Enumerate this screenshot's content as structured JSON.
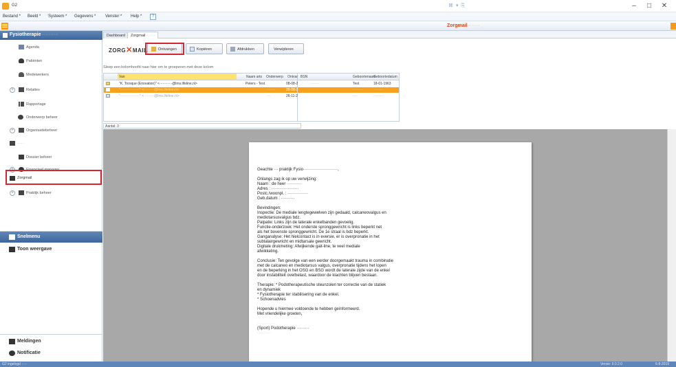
{
  "titlebar": {
    "app_title": "G2",
    "center_icons": "⌘ ▾ ⎘",
    "minimize": "–",
    "maximize": "□",
    "close": "✕"
  },
  "menu": {
    "items": [
      "Bestand *",
      "Beeld *",
      "Systeem *",
      "Gegevens *",
      "Venster *",
      "Help *"
    ]
  },
  "header": {
    "title": "Zorgmail",
    "subtitle": " - ·····"
  },
  "sidebar": {
    "heading": "Fysiotherapie",
    "heading_blur": " ··········",
    "items": [
      {
        "label": "Agenda"
      },
      {
        "label": "Patiënten"
      },
      {
        "label": "Medewerkers"
      },
      {
        "label": "Relaties"
      },
      {
        "label": "Rapportage"
      },
      {
        "label": "Onderwerp beheer"
      },
      {
        "label": "Organisatiebeheer"
      },
      {
        "label": "·····"
      },
      {
        "label": "Dossier beheer"
      },
      {
        "label": "Financieel manager"
      },
      {
        "label": "Zorgmail"
      },
      {
        "label": "Praktijk beheer"
      }
    ],
    "panels": [
      "Snelmenu",
      "Toon weergave",
      "Meldingen",
      "Notificatie"
    ]
  },
  "tabs": {
    "dashboard": "Dashboard",
    "zorgmail": "Zorgmail",
    "zorgmail_blur": " - ·····"
  },
  "toolbar": {
    "logo_left": "ZORG",
    "logo_x": "✕",
    "logo_right": "MAIL",
    "ontvangen": "Ontvangen",
    "kopieren": "Kopiëren",
    "afdrukken": "Afdrukken",
    "verwijderen": "Verwijderen"
  },
  "group_hint": "Sleep een kolomhoofd naar hier om te groeperen met deze kolom",
  "grid": {
    "columns": [
      "Van",
      "Naam arts",
      "Onderwerp",
      "Ontvangen",
      "BSN",
      "Geboortenaam",
      "Geboortedatum"
    ],
    "rows": [
      {
        "van": "\"K. Toroque (Enovation)\" <···········@lms.lifeline.nl>",
        "naam_arts": "Peters - Test",
        "onderwerp": "",
        "ontvangen": "08-08-2019 10:59:15",
        "bsn": "········",
        "geboortenaam": "Test",
        "geboortedatum": "18-01-1963"
      },
      {
        "van": "\"·················\" <·········@lms.lifeline.nl>",
        "naam_arts": "",
        "onderwerp": "·······",
        "ontvangen": "28-08-2014 12:59:15",
        "bsn": "",
        "geboortenaam": "·········",
        "geboortedatum": "·········"
      },
      {
        "van": "\"·················\" <·········@lms.lifeline.nl>",
        "naam_arts": "",
        "onderwerp": "····",
        "ontvangen": "26-11-2012 07:53:41",
        "bsn": "",
        "geboortenaam": "····",
        "geboortedatum": "·········"
      }
    ],
    "footer": "Aantal: 3"
  },
  "letter": {
    "salutation": "Geachte ··· praktijk Fysio·························,",
    "intro": [
      "Onlangs zag ik op uw verwijzing:",
      "Naam   : de heer ···········",
      "Adres  : ····················",
      "Postc./woonpl.  : ···············",
      "Geb.datum : ··········"
    ],
    "findings": [
      "Bevindingen:",
      "Inspectie: De mediale lengtegewelven zijn gedaald, calcaneovalgus en",
      "mediotarsusvalgus bdz.",
      "Palpatie: Links zijn de laterale enkelbanden gevoelig.",
      "Functie-onderzoek: Het onderste spronggewricht is links beperkt net",
      "als het bovenste spronggewricht. De 1e straal is bdz beperkt.",
      "Ganganalyse: Het hielcontact is in eversie, er is overpronatie in het",
      "subtalairgewricht en midtarsale gewricht.",
      "Digitale drukmeting: Afwijkende gait-line, te veel mediale",
      "afwikkeling."
    ],
    "conclusion": [
      "Conclusie: Ten gevolge van een eerder doorgemaakt trauma in combinatie",
      "met de calcaneo en mediotarsus valgus, overpronatie tijdens het lopen",
      "en de beperking in het OSG en BSG wordt de laterale zijde van de enkel",
      "door instabiliteit overbelast, waardoor de klachten blijven bestaan."
    ],
    "therapy": [
      "Therapie: * Podotherapeutische steunzolen ter correctie van de statiek",
      "en dynamiek",
      "* Fysiotherapie ter stabilisering van de enkel.",
      "* Schoenadvies"
    ],
    "closing": [
      "Hopende u hiermee voldoende te hebben geïnformeerd.",
      "Met vriendelijke groeten,"
    ],
    "signature": [
      "·············",
      "(Sport) Podotherapie ·········",
      "··········"
    ]
  },
  "status": {
    "left": "G2 ingelogd ·····",
    "version": "Versie: 9.0.2.0",
    "date": "6-8-2019"
  }
}
